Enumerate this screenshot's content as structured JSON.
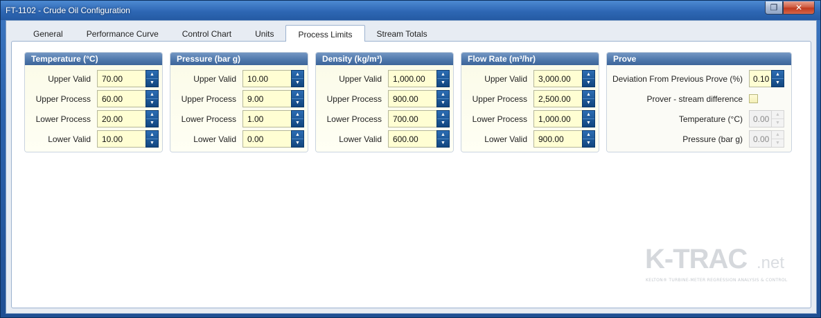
{
  "window": {
    "title": "FT-1102 - Crude Oil Configuration",
    "restore_icon": "restore-icon",
    "close_icon": "close-icon",
    "restore_glyph": "❐",
    "close_glyph": "✕"
  },
  "tabs": [
    {
      "label": "General"
    },
    {
      "label": "Performance Curve"
    },
    {
      "label": "Control Chart"
    },
    {
      "label": "Units"
    },
    {
      "label": "Process Limits",
      "active": true
    },
    {
      "label": "Stream Totals"
    }
  ],
  "groups": {
    "temperature": {
      "title": "Temperature (°C)",
      "rows": [
        {
          "label": "Upper Valid",
          "value": "70.00"
        },
        {
          "label": "Upper Process",
          "value": "60.00"
        },
        {
          "label": "Lower Process",
          "value": "20.00"
        },
        {
          "label": "Lower Valid",
          "value": "10.00"
        }
      ]
    },
    "pressure": {
      "title": "Pressure (bar g)",
      "rows": [
        {
          "label": "Upper Valid",
          "value": "10.00"
        },
        {
          "label": "Upper Process",
          "value": "9.00"
        },
        {
          "label": "Lower Process",
          "value": "1.00"
        },
        {
          "label": "Lower Valid",
          "value": "0.00"
        }
      ]
    },
    "density": {
      "title": "Density (kg/m³)",
      "rows": [
        {
          "label": "Upper Valid",
          "value": "1,000.00"
        },
        {
          "label": "Upper Process",
          "value": "900.00"
        },
        {
          "label": "Lower Process",
          "value": "700.00"
        },
        {
          "label": "Lower Valid",
          "value": "600.00"
        }
      ]
    },
    "flow_rate": {
      "title": "Flow Rate (m³/hr)",
      "rows": [
        {
          "label": "Upper Valid",
          "value": "3,000.00"
        },
        {
          "label": "Upper Process",
          "value": "2,500.00"
        },
        {
          "label": "Lower Process",
          "value": "1,000.00"
        },
        {
          "label": "Lower Valid",
          "value": "900.00"
        }
      ]
    },
    "prove": {
      "title": "Prove",
      "deviation_label": "Deviation From Previous Prove (%)",
      "deviation_value": "0.10",
      "stream_diff_label": "Prover - stream difference",
      "stream_diff_checked": false,
      "temperature_label": "Temperature (°C)",
      "temperature_value": "0.00",
      "pressure_label": "Pressure (bar g)",
      "pressure_value": "0.00"
    }
  },
  "spinner": {
    "up_glyph": "▲",
    "down_glyph": "▼",
    "up_icon": "chevron-up-icon",
    "down_icon": "chevron-down-icon"
  },
  "logo": {
    "main": "K-TRAC",
    "suffix": ".net",
    "tagline": "KELTON® TURBINE-METER REGRESSION ANALYSIS & CONTROL"
  },
  "colors": {
    "title_bar": "#2e67b4",
    "group_header": "#4d76aa",
    "field_background": "#fffed3",
    "spinner_button": "#1a5596"
  }
}
